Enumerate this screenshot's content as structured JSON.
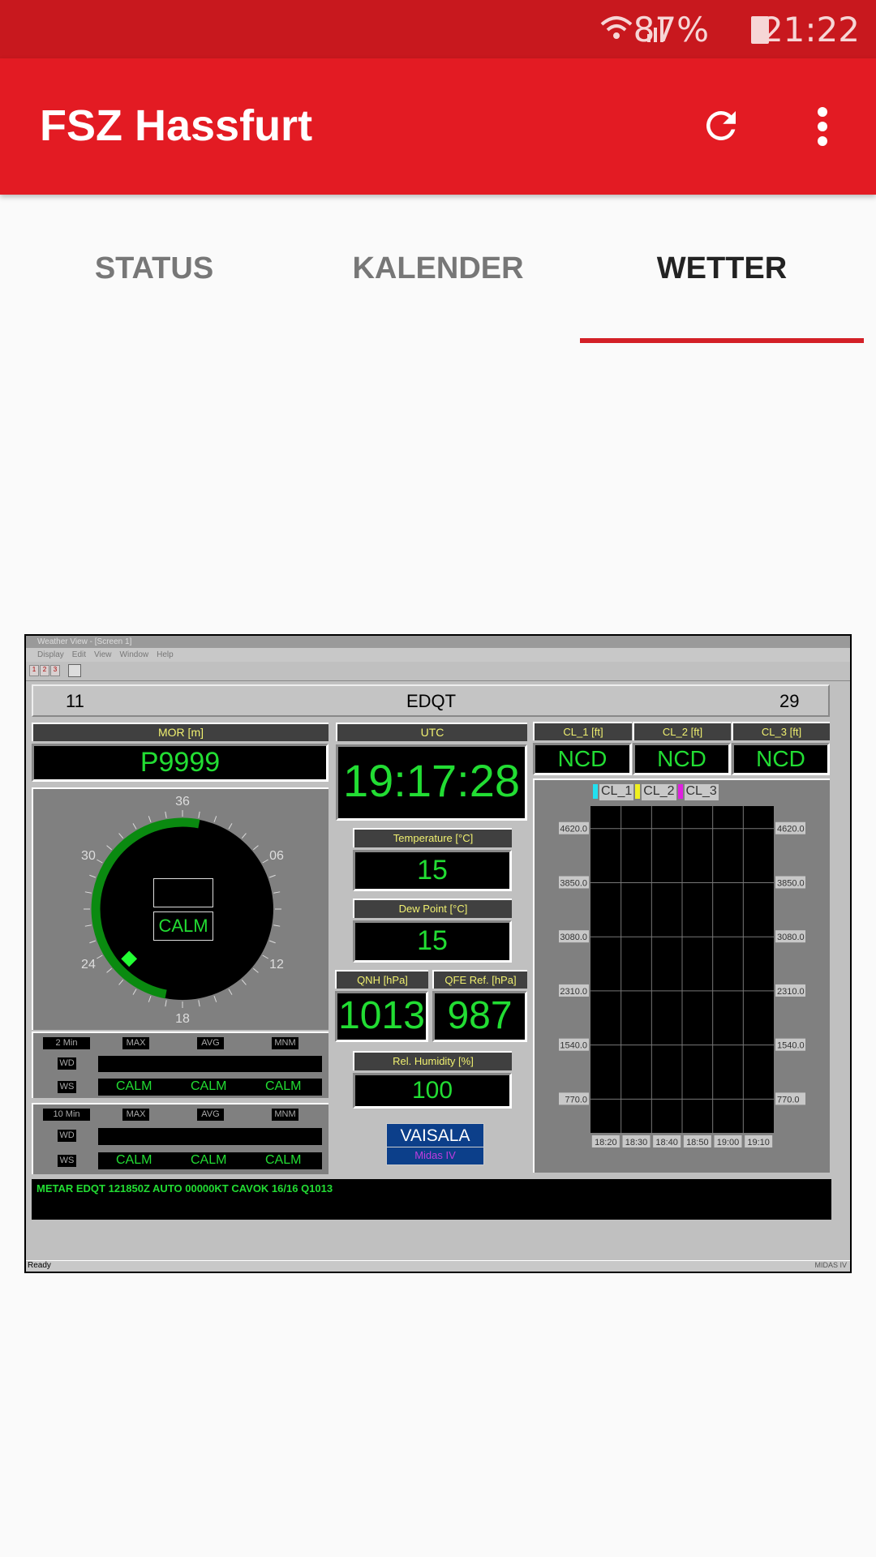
{
  "status_bar": {
    "battery": "87%",
    "time": "21:22",
    "icons": [
      "wifi-icon",
      "signal-icon",
      "battery-icon"
    ]
  },
  "app_bar": {
    "title": "FSZ Hassfurt",
    "actions": [
      "refresh-icon",
      "more-vert-icon"
    ]
  },
  "tabs": [
    {
      "label": "STATUS"
    },
    {
      "label": "KALENDER"
    },
    {
      "label": "WETTER",
      "active": true
    }
  ],
  "colors": {
    "primary": "#e31b23",
    "status_bar": "#c8181e",
    "indicator": "#d32027",
    "display_green": "#22dd33"
  },
  "weather": {
    "window_title": "Weather View - [Screen 1]",
    "menu": [
      "Display",
      "Edit",
      "View",
      "Window",
      "Help"
    ],
    "toolbar_buttons": [
      "1",
      "2",
      "3"
    ],
    "header": {
      "left": "11",
      "station": "EDQT",
      "right": "29"
    },
    "mor": {
      "label": "MOR [m]",
      "value": "P9999"
    },
    "utc": {
      "label": "UTC",
      "value": "19:17:28"
    },
    "temperature": {
      "label": "Temperature [°C]",
      "value": "15"
    },
    "dew_point": {
      "label": "Dew Point [°C]",
      "value": "15"
    },
    "qnh": {
      "label": "QNH [hPa]",
      "value": "1013"
    },
    "qfe": {
      "label": "QFE Ref. [hPa]",
      "value": "987"
    },
    "humidity": {
      "label": "Rel. Humidity [%]",
      "value": "100"
    },
    "logo": {
      "brand": "VAISALA",
      "product": "Midas IV"
    },
    "compass": {
      "labels": [
        "36",
        "06",
        "12",
        "18",
        "24",
        "30"
      ],
      "center_text": "CALM",
      "direction_deg": 227
    },
    "wind_2min": {
      "period": "2 Min",
      "cols": [
        "MAX",
        "AVG",
        "MNM"
      ],
      "wd": "WD",
      "ws": "WS",
      "ws_values": [
        "CALM",
        "CALM",
        "CALM"
      ]
    },
    "wind_10min": {
      "period": "10 Min",
      "cols": [
        "MAX",
        "AVG",
        "MNM"
      ],
      "wd": "WD",
      "ws": "WS",
      "ws_values": [
        "CALM",
        "CALM",
        "CALM"
      ]
    },
    "clouds": [
      {
        "label": "CL_1 [ft]",
        "value": "NCD"
      },
      {
        "label": "CL_2 [ft]",
        "value": "NCD"
      },
      {
        "label": "CL_3 [ft]",
        "value": "NCD"
      }
    ],
    "metar": "METAR EDQT 121850Z AUTO 00000KT CAVOK 16/16 Q1013",
    "status_left": "Ready",
    "status_right": "MIDAS IV"
  },
  "chart_data": {
    "type": "line",
    "legend": [
      {
        "name": "CL_1",
        "color": "#22e0f0"
      },
      {
        "name": "CL_2",
        "color": "#f0f020"
      },
      {
        "name": "CL_3",
        "color": "#e020e0"
      }
    ],
    "series": [
      {
        "name": "CL_1",
        "values": []
      },
      {
        "name": "CL_2",
        "values": []
      },
      {
        "name": "CL_3",
        "values": []
      }
    ],
    "x_ticks": [
      "18:20",
      "18:30",
      "18:40",
      "18:50",
      "19:00",
      "19:10"
    ],
    "y_ticks": [
      "4620.0",
      "3850.0",
      "3080.0",
      "2310.0",
      "1540.0",
      "770.0"
    ],
    "y_tick_values": [
      4620,
      3850,
      3080,
      2310,
      1540,
      770
    ],
    "ylim": [
      290,
      4940
    ],
    "grid": true,
    "legend_position": "top"
  }
}
